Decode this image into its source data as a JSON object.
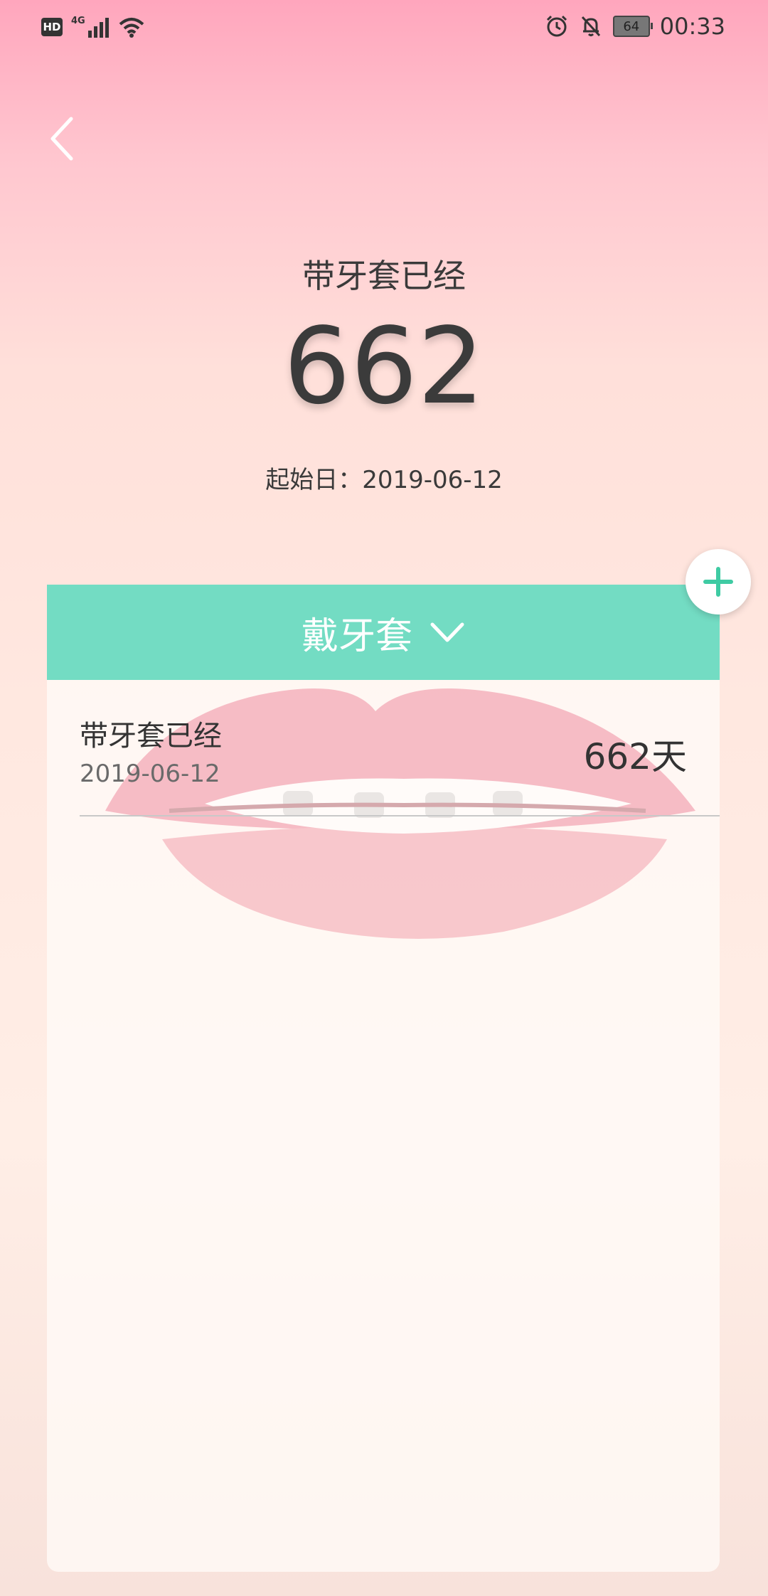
{
  "status_bar": {
    "hd": "HD",
    "network": "4G",
    "battery": "64",
    "time": "00:33"
  },
  "header": {
    "title": "带牙套已经",
    "days": "662",
    "start_label": "起始日：",
    "start_date": "2019-06-12"
  },
  "card": {
    "category": "戴牙套",
    "records": [
      {
        "title": "带牙套已经",
        "date": "2019-06-12",
        "days": "662天"
      }
    ]
  },
  "colors": {
    "accent": "#73dcc3",
    "text": "#3a3a3a"
  },
  "icons": {
    "back": "chevron-left-icon",
    "dropdown": "chevron-down-icon",
    "add": "plus-icon",
    "alarm": "alarm-icon",
    "mute": "bell-off-icon",
    "wifi": "wifi-icon",
    "signal": "signal-icon"
  }
}
